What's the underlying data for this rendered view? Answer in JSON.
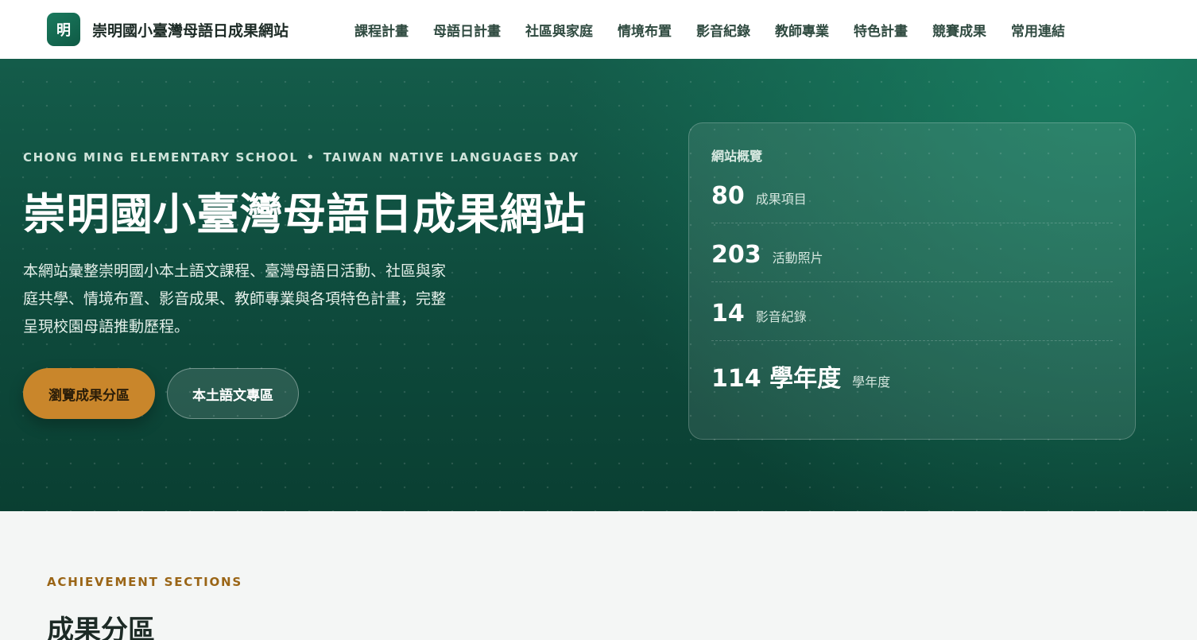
{
  "header": {
    "logo_char": "明",
    "site_name": "崇明國小臺灣母語日成果網站",
    "nav": [
      "課程計畫",
      "母語日計畫",
      "社區與家庭",
      "情境布置",
      "影音紀錄",
      "教師專業",
      "特色計畫",
      "競賽成果",
      "常用連結"
    ]
  },
  "hero": {
    "eyebrow_left": "CHONG MING ELEMENTARY SCHOOL",
    "eyebrow_sep": "•",
    "eyebrow_right": "TAIWAN NATIVE LANGUAGES DAY",
    "title": "崇明國小臺灣母語日成果網站",
    "description": "本網站彙整崇明國小本土語文課程、臺灣母語日活動、社區與家庭共學、情境布置、影音成果、教師專業與各項特色計畫，完整呈現校園母語推動歷程。",
    "primary_button": "瀏覽成果分區",
    "secondary_button": "本土語文專區"
  },
  "overview": {
    "title": "網站概覽",
    "stats": [
      {
        "num": "80",
        "label": "成果項目"
      },
      {
        "num": "203",
        "label": "活動照片"
      },
      {
        "num": "14",
        "label": "影音紀錄"
      },
      {
        "num": "114 學年度",
        "label": "學年度"
      }
    ]
  },
  "section": {
    "eyebrow": "ACHIEVEMENT SECTIONS",
    "title": "成果分區"
  },
  "colors": {
    "brand_green": "#0f5a45",
    "accent_gold": "#c9862b",
    "hero_dark": "#0a3f32"
  }
}
